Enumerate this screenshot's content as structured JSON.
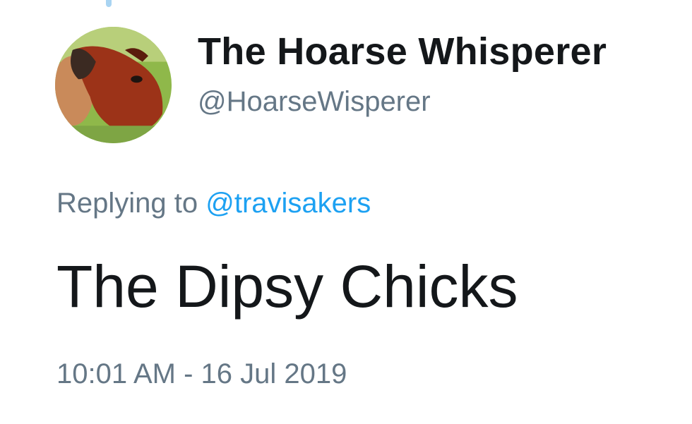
{
  "tweet": {
    "display_name": "The Hoarse Whisperer",
    "handle": "@HoarseWisperer",
    "replying_prefix": "Replying to",
    "replying_to": "@travisakers",
    "text": "The Dipsy Chicks",
    "timestamp": "10:01 AM - 16 Jul 2019",
    "avatar_icon": "horse-avatar"
  },
  "colors": {
    "name": "#14171a",
    "secondary": "#657786",
    "link": "#1da1f2",
    "thread_line": "#a9d4f2"
  }
}
